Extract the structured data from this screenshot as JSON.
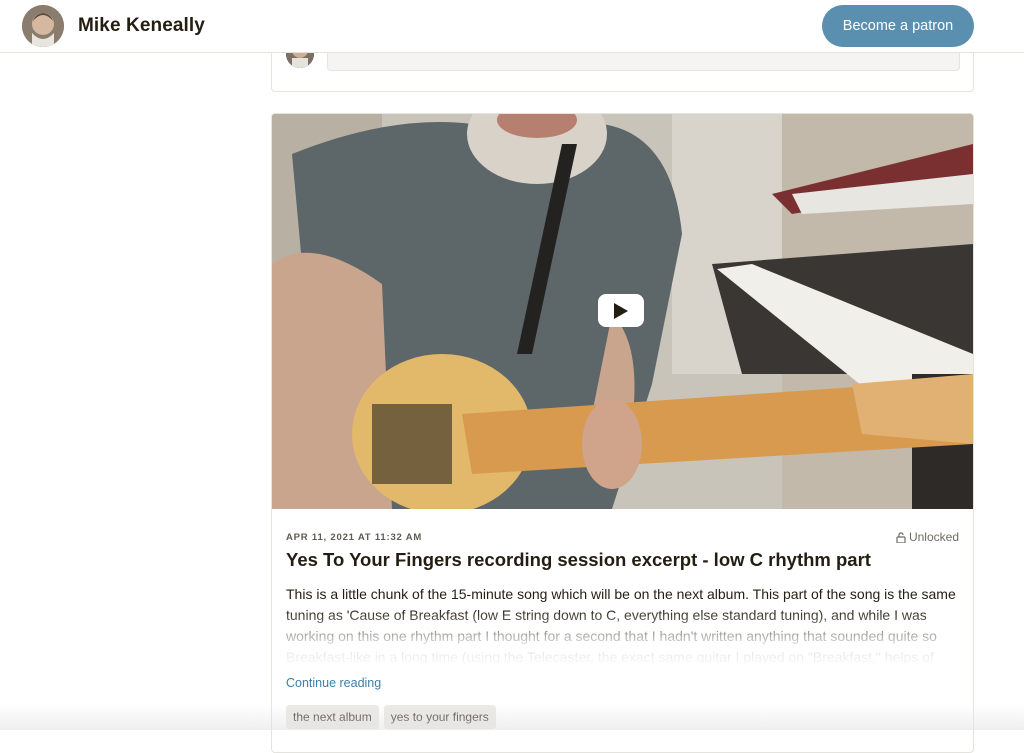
{
  "header": {
    "creator_name": "Mike Keneally",
    "patron_button": "Become a patron"
  },
  "post": {
    "date": "APR 11, 2021 AT 11:32 AM",
    "access": "Unlocked",
    "title": "Yes To Your Fingers recording session excerpt - low C rhythm part",
    "body": "This is a little chunk of the 15-minute song which will be on the next album. This part of the song is the same tuning as 'Cause of Breakfast (low E string down to C, everything else standard tuning), and while I was working on this one rhythm part I thought for a second that I hadn't written anything that sounded quite so Breakfast-like in a long time (using the Telecaster, the exact same guitar I played on \"Breakfast,\" helps of",
    "continue_label": "Continue reading",
    "tags": [
      "the next album",
      "yes to your fingers"
    ],
    "media_icon": "play-icon",
    "lock_icon": "unlock-icon"
  },
  "colors": {
    "accent": "#5b8fb0",
    "link": "#3d7fab"
  }
}
